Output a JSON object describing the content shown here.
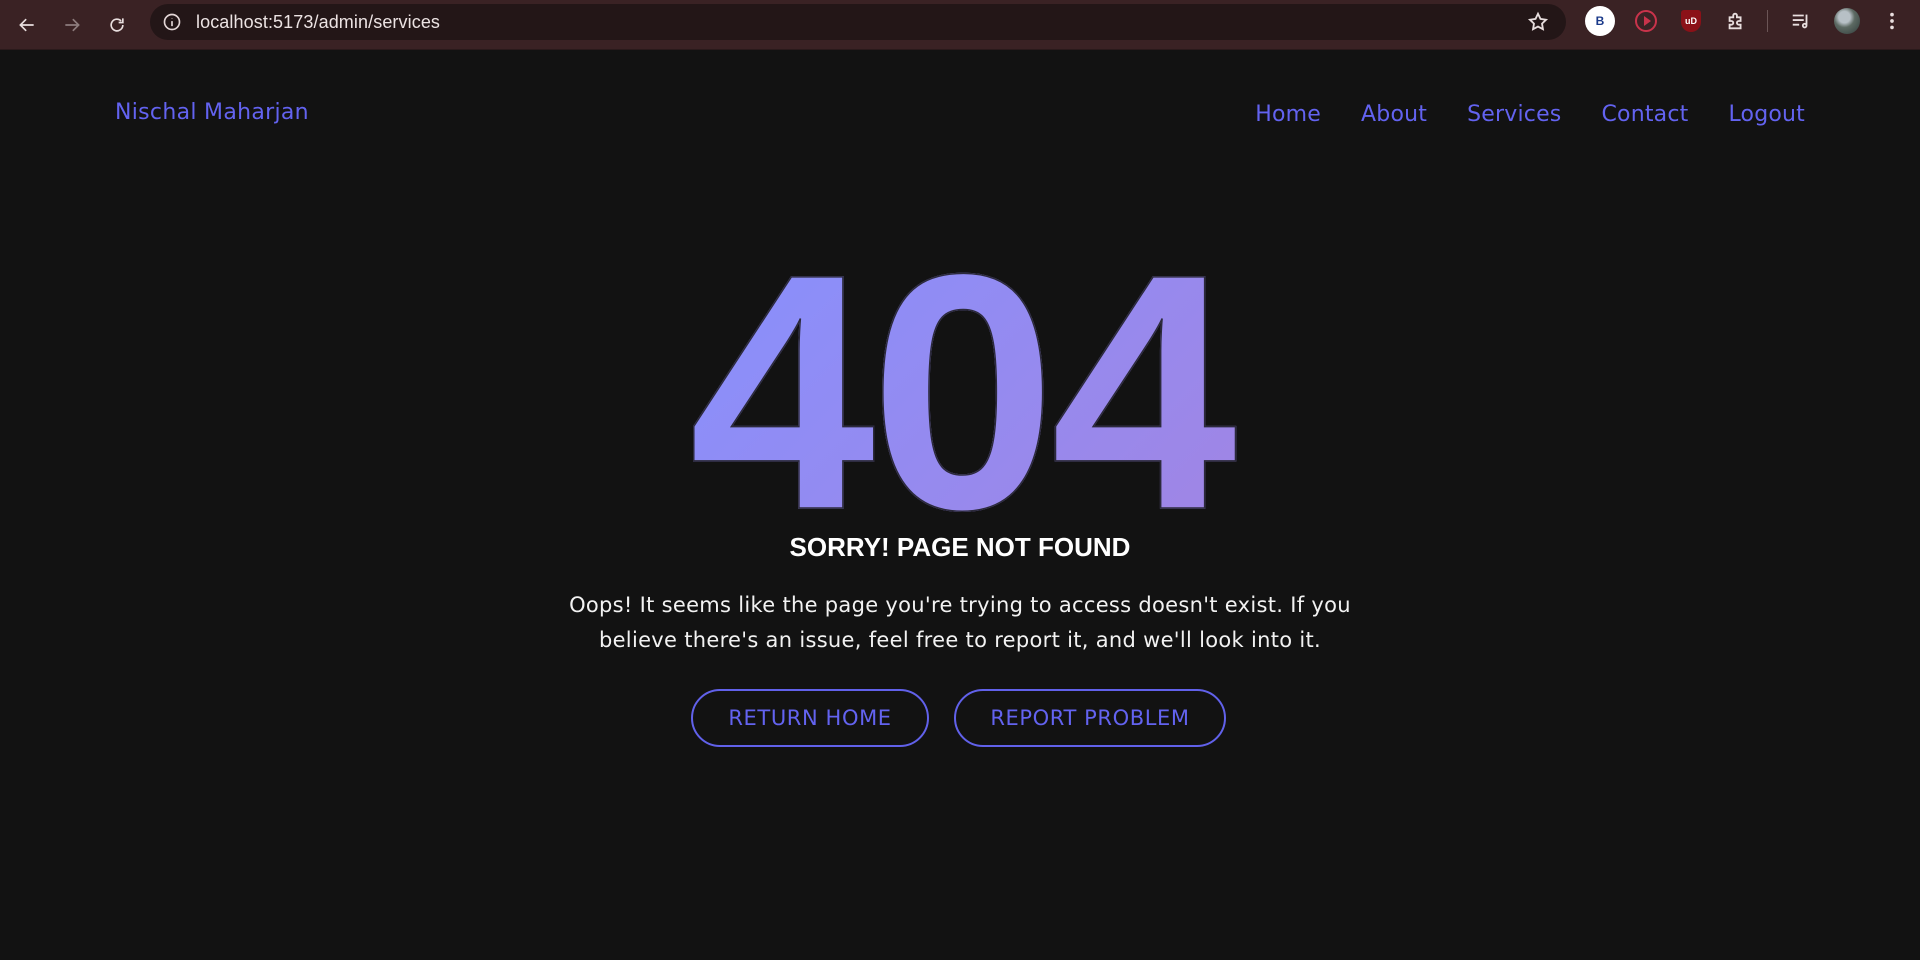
{
  "browser": {
    "url": "localhost:5173/admin/services",
    "extensions": [
      "B",
      "play-extension",
      "uD"
    ]
  },
  "site": {
    "brand": "Nischal Maharjan",
    "nav": [
      "Home",
      "About",
      "Services",
      "Contact",
      "Logout"
    ]
  },
  "error": {
    "code": "404",
    "title": "SORRY! PAGE NOT FOUND",
    "message": "Oops! It seems like the page you're trying to access doesn't exist. If you believe there's an issue, feel free to report it, and we'll look into it.",
    "primary_button": "RETURN HOME",
    "secondary_button": "REPORT PROBLEM"
  },
  "colors": {
    "background": "#121212",
    "accent": "#6363f0",
    "chrome": "#3a2224"
  }
}
